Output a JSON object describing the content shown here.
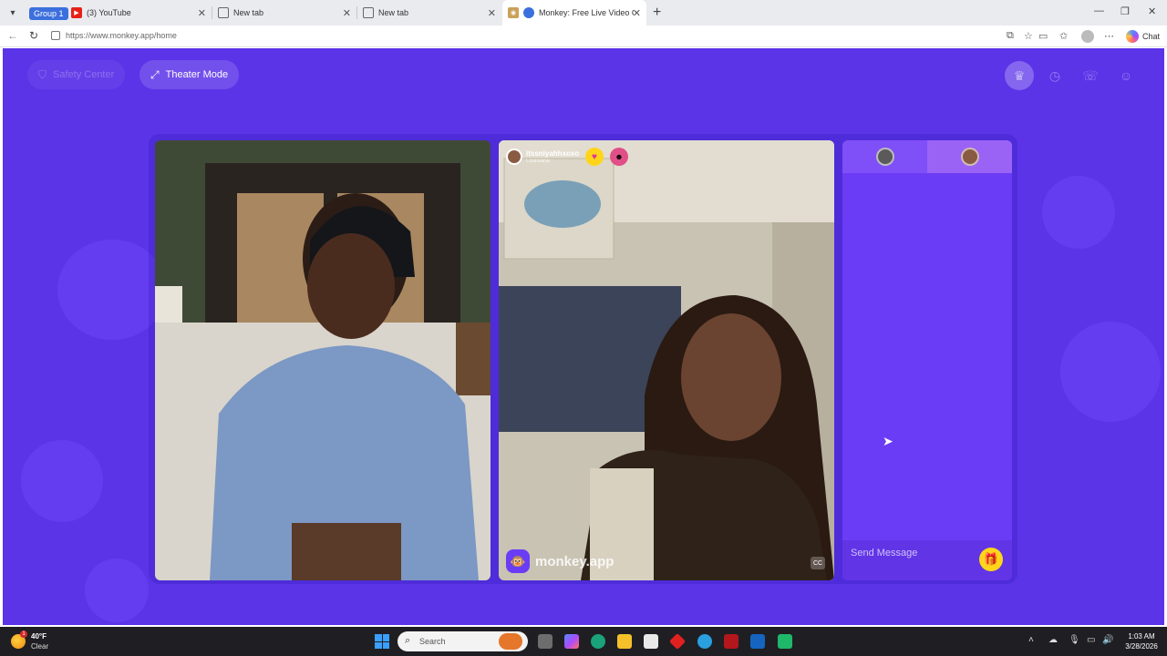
{
  "browser": {
    "tab_group_label": "Group 1",
    "tabs": [
      {
        "title": "(3) YouTube",
        "favicon": "youtube-icon"
      },
      {
        "title": "New tab",
        "favicon": "newtab-icon"
      },
      {
        "title": "New tab",
        "favicon": "newtab-icon"
      },
      {
        "title": "Monkey: Free Live Video Chat",
        "favicon": "monkey-icon",
        "active": true
      }
    ],
    "url": "https://www.monkey.app/home",
    "chat_button_label": "Chat"
  },
  "page": {
    "safety_center_label": "Safety Center",
    "theater_mode_label": "Theater Mode",
    "top_icons": [
      "crown-icon",
      "history-icon",
      "chat-bubble-icon",
      "monkey-face-icon"
    ],
    "background_color": "#5b34e8"
  },
  "remote_user": {
    "username": "itssniyahhxoxo",
    "location": "Louisiana"
  },
  "video_brand": "monkey.app",
  "chat": {
    "message_placeholder": "Send Message"
  },
  "taskbar": {
    "temperature": "40°F",
    "condition": "Clear",
    "notification_count": "1",
    "search_placeholder": "Search",
    "time": "1:03 AM",
    "date": "3/28/2026"
  }
}
